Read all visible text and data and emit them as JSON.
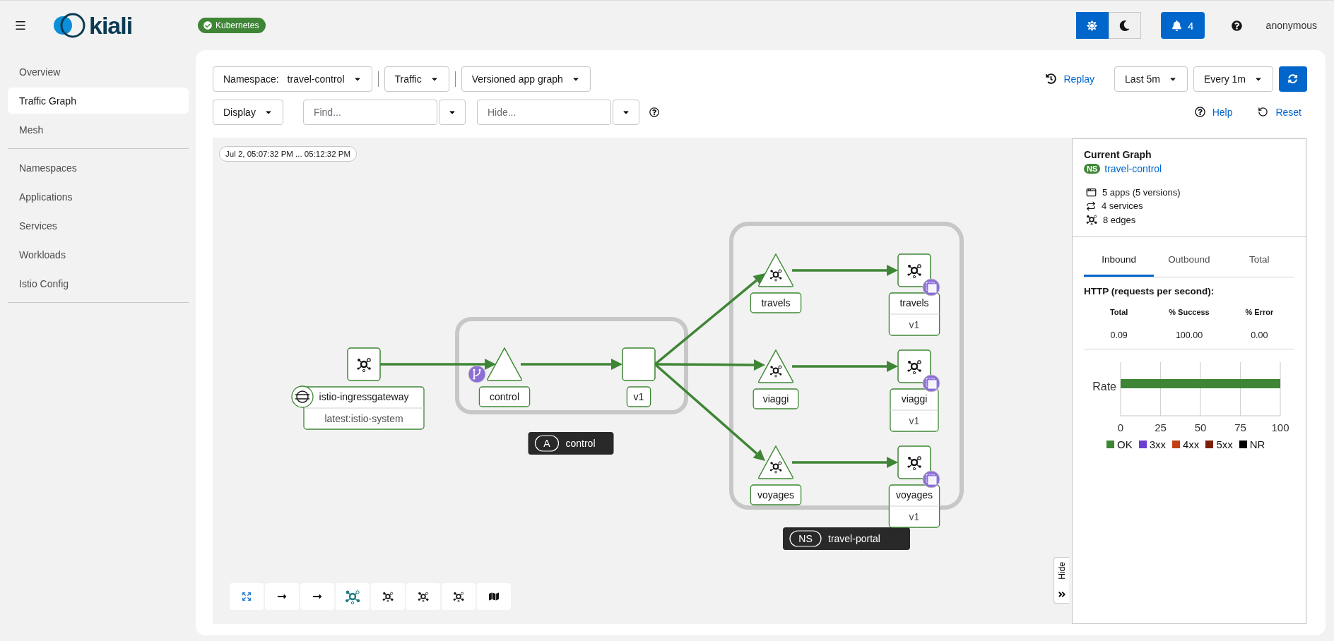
{
  "header": {
    "logo": "kiali",
    "cluster_badge": "Kubernetes",
    "theme_buttons": [
      {
        "kind": "light",
        "selected": true
      },
      {
        "kind": "dark",
        "selected": false
      }
    ],
    "notifications": "4",
    "user": "anonymous"
  },
  "sidebar": {
    "sections": [
      [
        {
          "label": "Overview",
          "selected": false
        },
        {
          "label": "Traffic Graph",
          "selected": true
        },
        {
          "label": "Mesh",
          "selected": false
        }
      ],
      [
        {
          "label": "Namespaces",
          "selected": false
        },
        {
          "label": "Applications",
          "selected": false
        },
        {
          "label": "Services",
          "selected": false
        },
        {
          "label": "Workloads",
          "selected": false
        },
        {
          "label": "Istio Config",
          "selected": false
        }
      ]
    ]
  },
  "toolbar": {
    "namespace_label": "Namespace:",
    "namespace": "travel-control",
    "traffic": "Traffic",
    "graph_type": "Versioned app graph",
    "display": "Display",
    "find_placeholder": "Find...",
    "hide_placeholder": "Hide...",
    "replay": "Replay",
    "duration": "Last 5m",
    "refresh_interval": "Every 1m",
    "help": "Help",
    "reset": "Reset"
  },
  "graph": {
    "timestamp": "Jul 2, 05:07:32 PM ... 05:12:32 PM",
    "groups": [
      {
        "kind": "app",
        "badge": "A",
        "name": "control"
      },
      {
        "kind": "namespace",
        "badge": "NS",
        "name": "travel-portal"
      }
    ],
    "nodes": [
      {
        "kind": "workload",
        "name": "istio-ingressgateway",
        "version": "latest:istio-system",
        "icon": true,
        "gateway_badge": true,
        "route_badge": false,
        "proxy_badge": false,
        "children": [
          {
            "kind": "service",
            "name": "control",
            "icon": false,
            "gateway_badge": false,
            "route_badge": true,
            "proxy_badge": false,
            "children": [
              {
                "kind": "app",
                "name": "v1",
                "icon": false,
                "gateway_badge": false,
                "route_badge": false,
                "proxy_badge": false,
                "children": [
                  {
                    "kind": "service",
                    "name": "travels",
                    "icon": true,
                    "gateway_badge": false,
                    "route_badge": false,
                    "proxy_badge": false,
                    "children": [
                      {
                        "kind": "workload",
                        "name": "travels",
                        "version": "v1",
                        "icon": true,
                        "gateway_badge": false,
                        "route_badge": false,
                        "proxy_badge": true
                      }
                    ]
                  },
                  {
                    "kind": "service",
                    "name": "viaggi",
                    "icon": true,
                    "gateway_badge": false,
                    "route_badge": false,
                    "proxy_badge": false,
                    "children": [
                      {
                        "kind": "workload",
                        "name": "viaggi",
                        "version": "v1",
                        "icon": true,
                        "gateway_badge": false,
                        "route_badge": false,
                        "proxy_badge": true
                      }
                    ]
                  },
                  {
                    "kind": "service",
                    "name": "voyages",
                    "icon": true,
                    "gateway_badge": false,
                    "route_badge": false,
                    "proxy_badge": false,
                    "children": [
                      {
                        "kind": "workload",
                        "name": "voyages",
                        "version": "v1",
                        "icon": true,
                        "gateway_badge": false,
                        "route_badge": false,
                        "proxy_badge": true
                      }
                    ]
                  }
                ]
              }
            ]
          }
        ]
      }
    ],
    "tools": [
      {
        "kind": "fit",
        "selected": false
      },
      {
        "kind": "arrow",
        "selected": false
      },
      {
        "kind": "arrow",
        "selected": false
      },
      {
        "kind": "layout",
        "selected": true
      },
      {
        "kind": "layout",
        "selected": false
      },
      {
        "kind": "layout",
        "selected": false
      },
      {
        "kind": "layout",
        "selected": false
      },
      {
        "kind": "map",
        "selected": false
      }
    ],
    "hide_tab": "Hide"
  },
  "side_panel": {
    "title": "Current Graph",
    "namespace_badge": "NS",
    "namespace": "travel-control",
    "stats": [
      {
        "kind": "apps",
        "text": "5 apps (5 versions)"
      },
      {
        "kind": "services",
        "text": "4 services"
      },
      {
        "kind": "edges",
        "text": "8 edges"
      }
    ],
    "tabs": [
      {
        "label": "Inbound",
        "selected": true
      },
      {
        "label": "Outbound",
        "selected": false
      },
      {
        "label": "Total",
        "selected": false
      }
    ],
    "http_title": "HTTP (requests per second):",
    "table": {
      "columns": [
        "Total",
        "% Success",
        "% Error"
      ],
      "values": [
        "0.09",
        "100.00",
        "0.00"
      ]
    },
    "chart_data": {
      "type": "bar",
      "orientation": "horizontal",
      "stacked": true,
      "grid": true,
      "categories": [
        "Rate"
      ],
      "xlim": [
        0,
        100
      ],
      "xticks": [
        0,
        25,
        50,
        75,
        100
      ],
      "series": [
        {
          "name": "OK",
          "color": "#3e8635",
          "values": [
            100
          ]
        },
        {
          "name": "3xx",
          "color": "#6c3fd1",
          "values": [
            0
          ]
        },
        {
          "name": "4xx",
          "color": "#c23f14",
          "values": [
            0
          ]
        },
        {
          "name": "5xx",
          "color": "#7d1f07",
          "values": [
            0
          ]
        },
        {
          "name": "NR",
          "color": "#000000",
          "values": [
            0
          ]
        }
      ]
    }
  }
}
